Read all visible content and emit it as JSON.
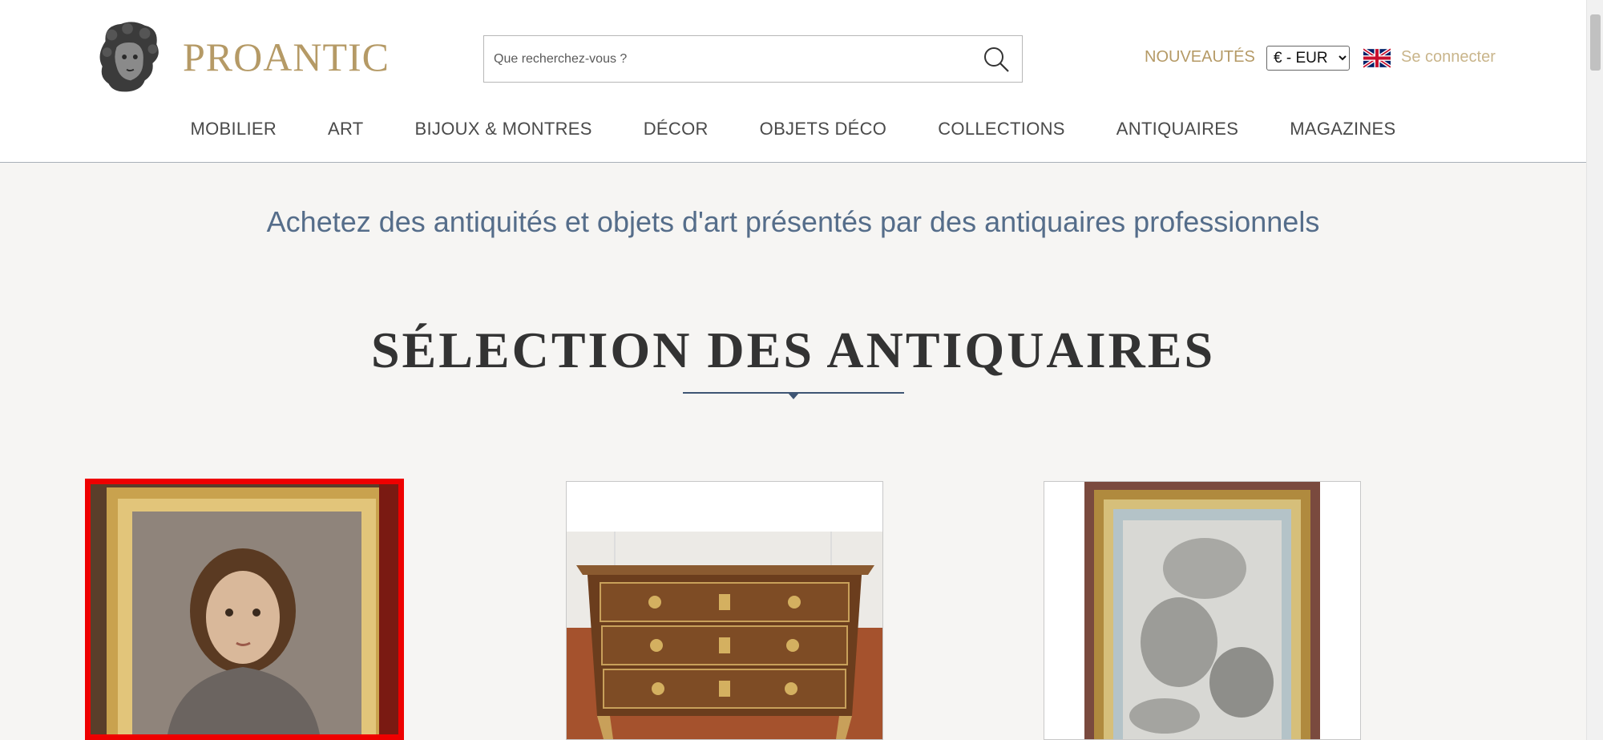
{
  "site": {
    "brand": "PROANTIC"
  },
  "search": {
    "placeholder": "Que recherchez-vous ?"
  },
  "header": {
    "new_label": "NOUVEAUTÉS",
    "currency": "€ - EUR",
    "login_label": "Se connecter",
    "language_icon": "uk-flag-icon"
  },
  "nav": {
    "items": [
      "MOBILIER",
      "ART",
      "BIJOUX & MONTRES",
      "DÉCOR",
      "OBJETS DÉCO",
      "COLLECTIONS",
      "ANTIQUAIRES",
      "MAGAZINES"
    ]
  },
  "main": {
    "tagline": "Achetez des antiquités et objets d'art présentés par des antiquaires professionnels",
    "section_title": "SÉLECTION DES ANTIQUAIRES"
  },
  "products": [
    {
      "image": "portrait-of-girl-in-gilt-frame",
      "selected": true
    },
    {
      "image": "walnut-commode-chest-of-drawers",
      "selected": false
    },
    {
      "image": "framed-mythological-drawing",
      "selected": false
    }
  ],
  "colors": {
    "gold": "#b59a66",
    "navy": "#3e5573",
    "tagline": "#556d8a",
    "selection_red": "#ee0000",
    "background": "#f6f5f3"
  }
}
